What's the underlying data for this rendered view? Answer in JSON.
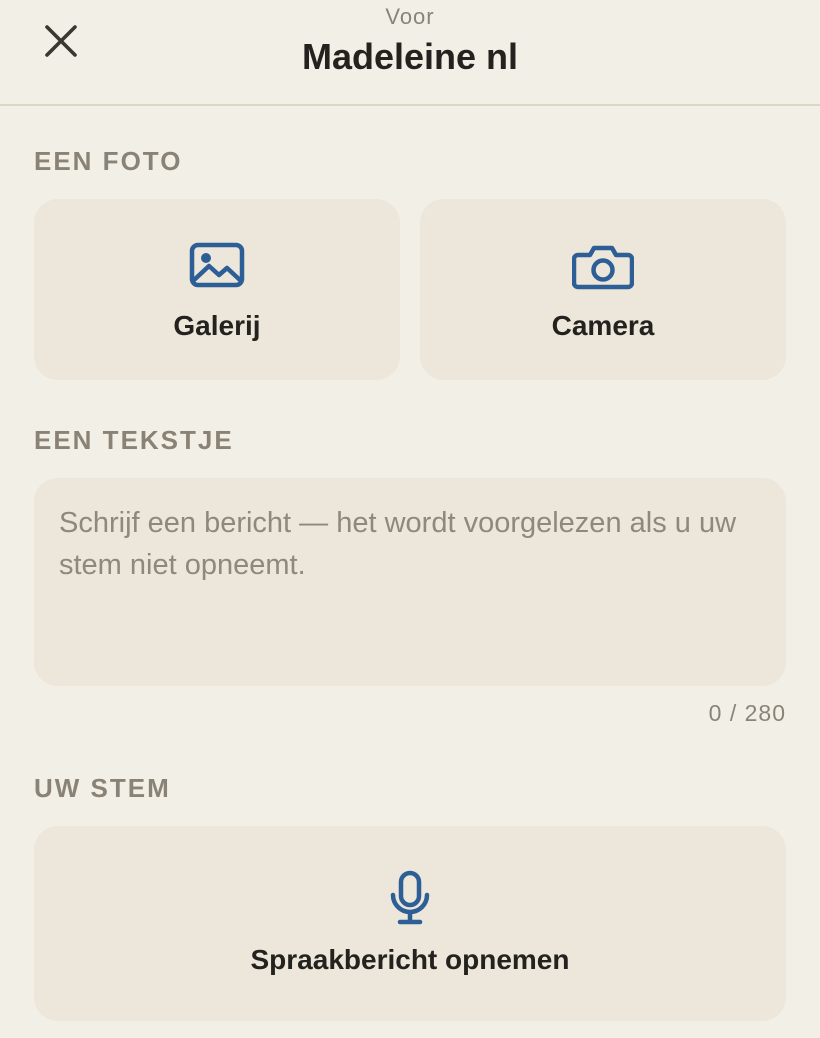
{
  "header": {
    "close_icon": "close-icon",
    "prefix": "Voor",
    "recipient": "Madeleine nl"
  },
  "photo_section": {
    "label": "EEN FOTO",
    "gallery_label": "Galerij",
    "gallery_icon": "image-icon",
    "camera_label": "Camera",
    "camera_icon": "camera-icon"
  },
  "text_section": {
    "label": "EEN TEKSTJE",
    "value": "",
    "placeholder": "Schrijf een bericht — het wordt voorgelezen als u uw stem niet opneemt.",
    "counter": "0 / 280"
  },
  "voice_section": {
    "label": "UW STEM",
    "record_label": "Spraakbericht opnemen",
    "record_icon": "microphone-icon"
  },
  "colors": {
    "background": "#f2efe7",
    "tile": "#ece6db",
    "accent": "#2d5f96",
    "section_label": "#8a8375",
    "text": "#24221e"
  }
}
